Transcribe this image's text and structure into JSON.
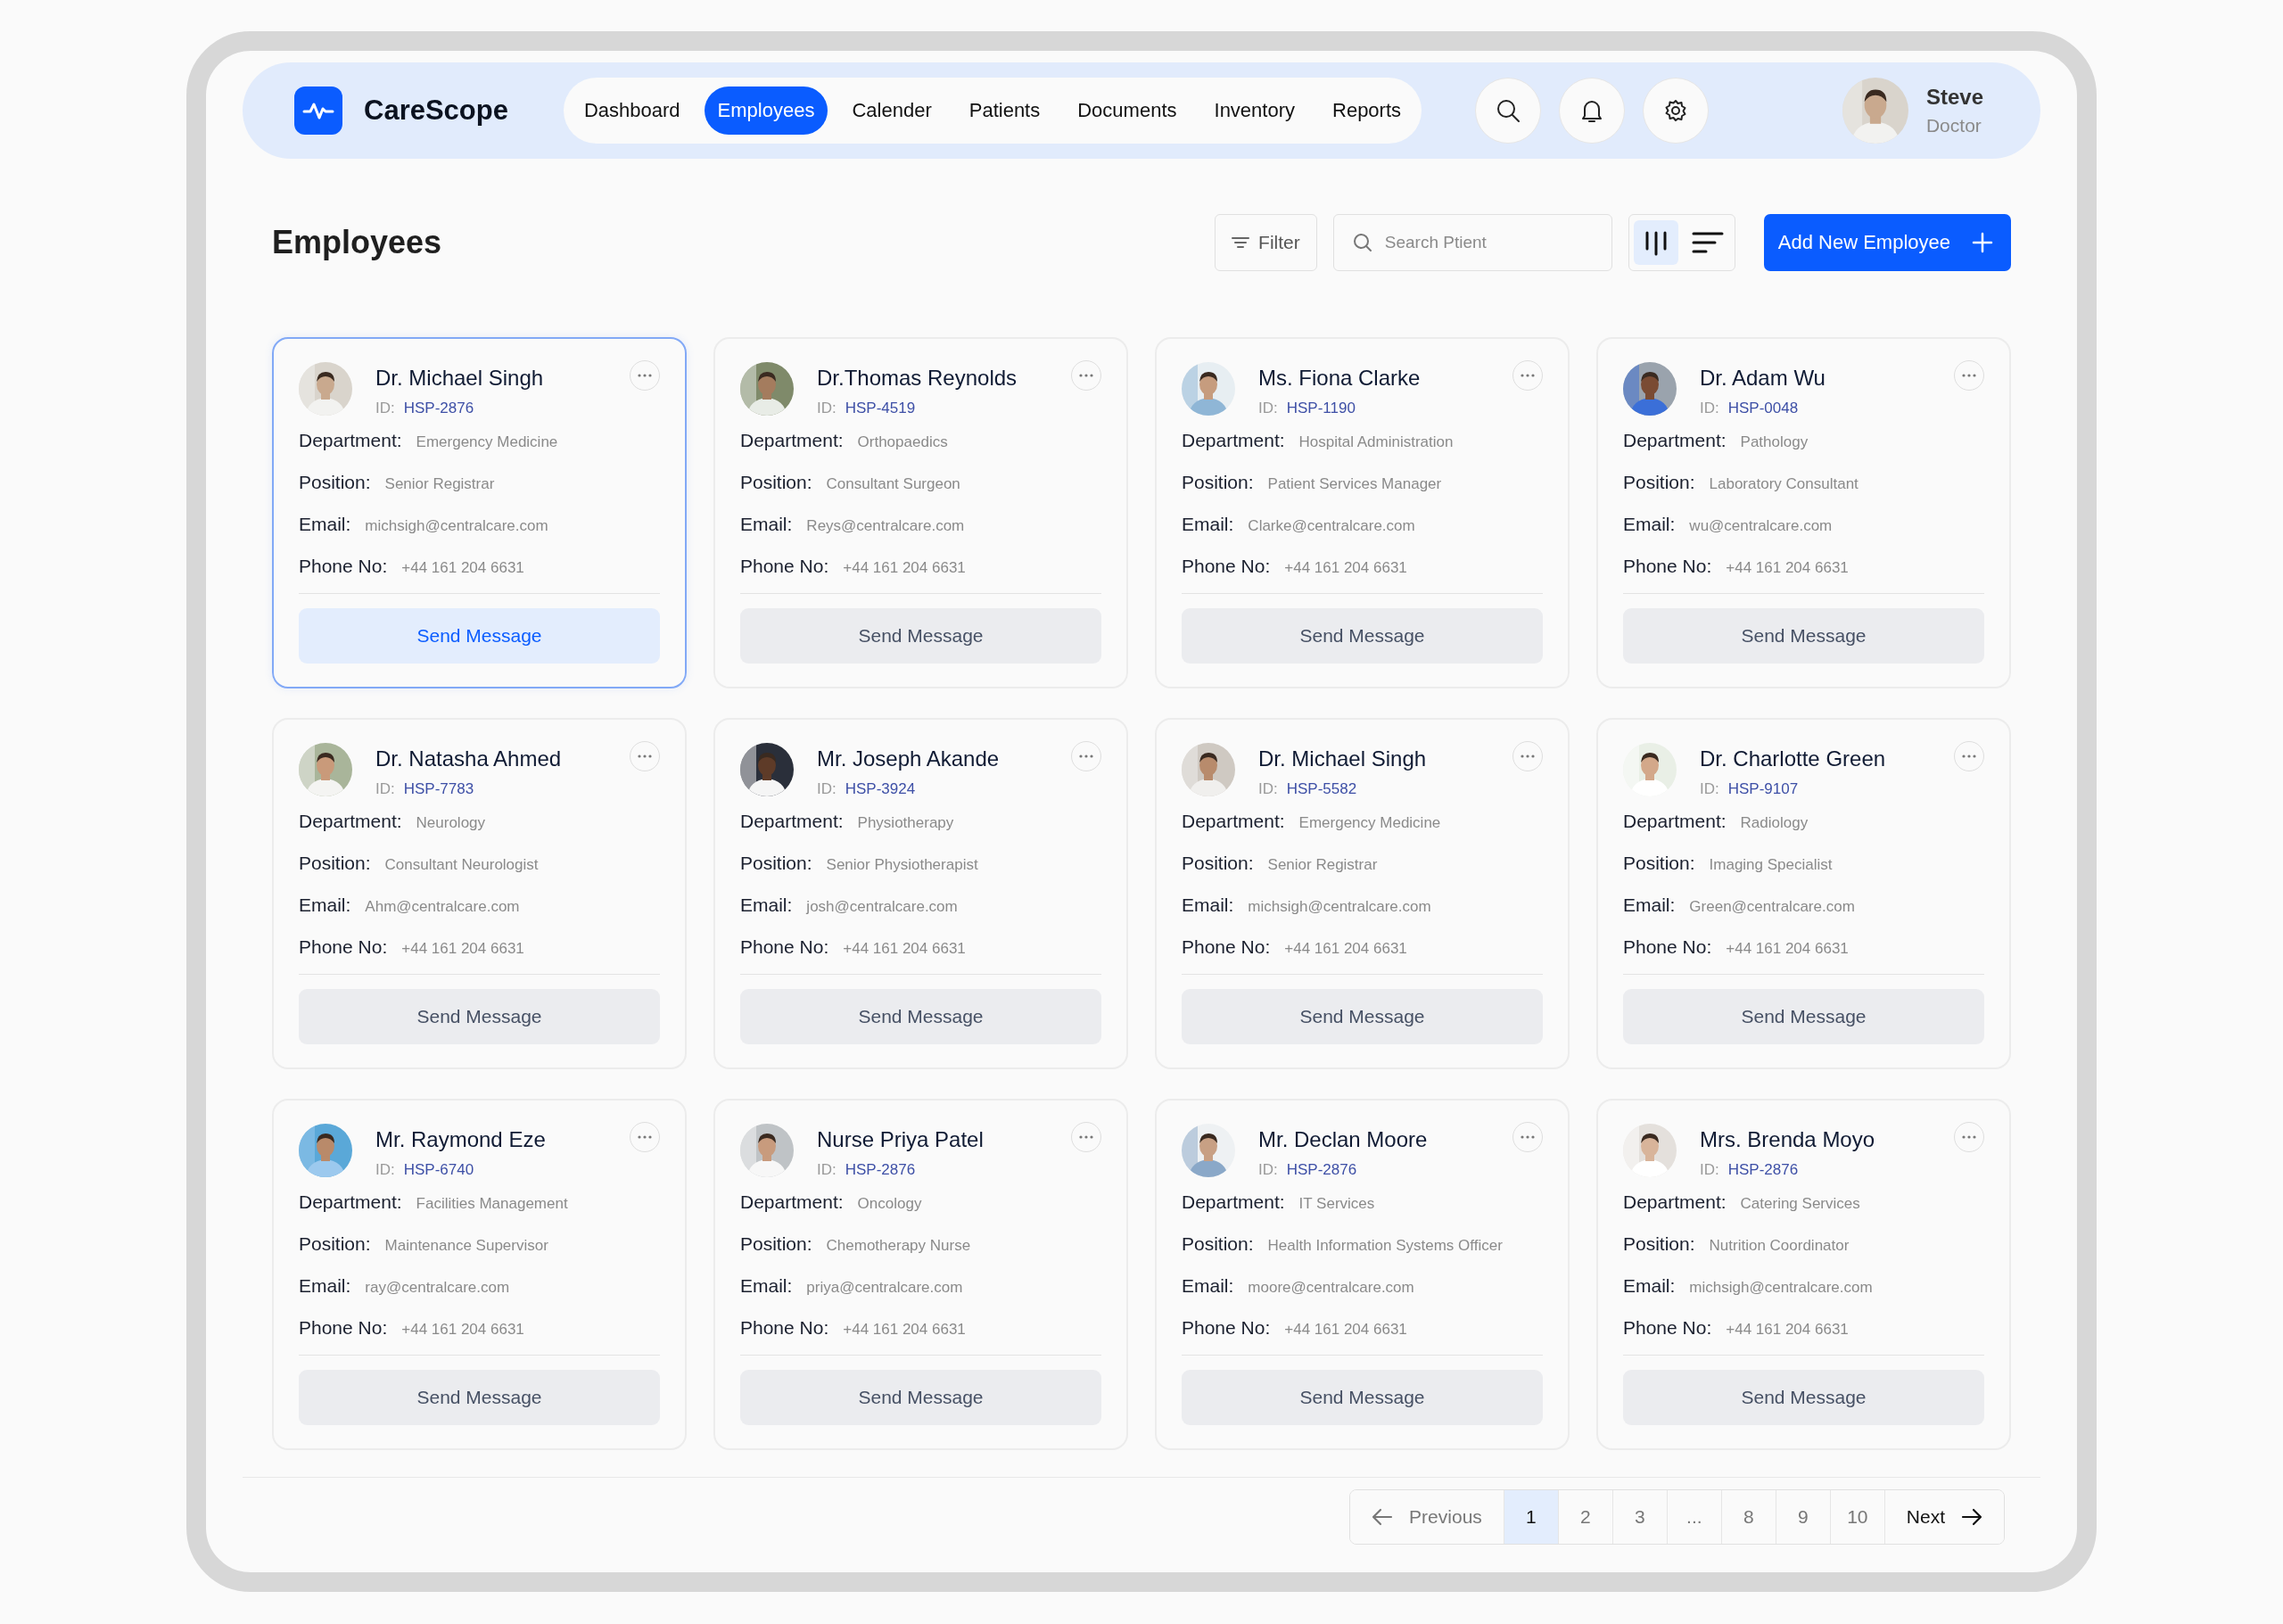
{
  "brand": {
    "name": "CareScope"
  },
  "nav": [
    {
      "label": "Dashboard",
      "selected": false
    },
    {
      "label": "Employees",
      "selected": true
    },
    {
      "label": "Calender",
      "selected": false
    },
    {
      "label": "Patients",
      "selected": false
    },
    {
      "label": "Documents",
      "selected": false
    },
    {
      "label": "Inventory",
      "selected": false
    },
    {
      "label": "Reports",
      "selected": false
    }
  ],
  "user": {
    "name": "Steve",
    "role": "Doctor"
  },
  "page_title": "Employees",
  "toolbar": {
    "filter": "Filter",
    "search": {
      "placeholder": "Search Ptient"
    },
    "view_options": [
      {
        "kind": "columns",
        "selected": true
      },
      {
        "kind": "rows",
        "selected": false
      }
    ],
    "add_button": "Add New Employee"
  },
  "employees": [
    {
      "name": "Dr. Michael Singh",
      "id_label": "ID:",
      "id": "HSP-2876",
      "selected": true,
      "fields": [
        {
          "label": "Department:",
          "value": "Emergency Medicine"
        },
        {
          "label": "Position:",
          "value": "Senior Registrar"
        },
        {
          "label": "Email:",
          "value": "michsigh@centralcare.com"
        },
        {
          "label": "Phone No:",
          "value": "+44 161 204 6631"
        }
      ],
      "button": "Send Message"
    },
    {
      "name": "Dr.Thomas Reynolds",
      "id_label": "ID:",
      "id": "HSP-4519",
      "selected": false,
      "fields": [
        {
          "label": "Department:",
          "value": "Orthopaedics"
        },
        {
          "label": "Position:",
          "value": "Consultant Surgeon"
        },
        {
          "label": "Email:",
          "value": "Reys@centralcare.com"
        },
        {
          "label": "Phone No:",
          "value": "+44 161 204 6631"
        }
      ],
      "button": "Send Message"
    },
    {
      "name": "Ms. Fiona Clarke",
      "id_label": "ID:",
      "id": "HSP-1190",
      "selected": false,
      "fields": [
        {
          "label": "Department:",
          "value": "Hospital Administration"
        },
        {
          "label": "Position:",
          "value": "Patient Services Manager"
        },
        {
          "label": "Email:",
          "value": "Clarke@centralcare.com"
        },
        {
          "label": "Phone No:",
          "value": "+44 161 204 6631"
        }
      ],
      "button": "Send Message"
    },
    {
      "name": "Dr. Adam Wu",
      "id_label": "ID:",
      "id": "HSP-0048",
      "selected": false,
      "fields": [
        {
          "label": "Department:",
          "value": "Pathology"
        },
        {
          "label": "Position:",
          "value": "Laboratory Consultant"
        },
        {
          "label": "Email:",
          "value": "wu@centralcare.com"
        },
        {
          "label": "Phone No:",
          "value": "+44 161 204 6631"
        }
      ],
      "button": "Send Message"
    },
    {
      "name": "Dr. Natasha Ahmed",
      "id_label": "ID:",
      "id": "HSP-7783",
      "selected": false,
      "fields": [
        {
          "label": "Department:",
          "value": "Neurology"
        },
        {
          "label": "Position:",
          "value": "Consultant Neurologist"
        },
        {
          "label": "Email:",
          "value": "Ahm@centralcare.com"
        },
        {
          "label": "Phone No:",
          "value": "+44 161 204 6631"
        }
      ],
      "button": "Send Message"
    },
    {
      "name": "Mr. Joseph Akande",
      "id_label": "ID:",
      "id": "HSP-3924",
      "selected": false,
      "fields": [
        {
          "label": "Department:",
          "value": "Physiotherapy"
        },
        {
          "label": "Position:",
          "value": "Senior Physiotherapist"
        },
        {
          "label": "Email:",
          "value": "josh@centralcare.com"
        },
        {
          "label": "Phone No:",
          "value": "+44 161 204 6631"
        }
      ],
      "button": "Send Message"
    },
    {
      "name": "Dr. Michael Singh",
      "id_label": "ID:",
      "id": "HSP-5582",
      "selected": false,
      "fields": [
        {
          "label": "Department:",
          "value": "Emergency Medicine"
        },
        {
          "label": "Position:",
          "value": "Senior Registrar"
        },
        {
          "label": "Email:",
          "value": "michsigh@centralcare.com"
        },
        {
          "label": "Phone No:",
          "value": "+44 161 204 6631"
        }
      ],
      "button": "Send Message"
    },
    {
      "name": "Dr. Charlotte Green",
      "id_label": "ID:",
      "id": "HSP-9107",
      "selected": false,
      "fields": [
        {
          "label": "Department:",
          "value": "Radiology"
        },
        {
          "label": "Position:",
          "value": "Imaging Specialist"
        },
        {
          "label": "Email:",
          "value": "Green@centralcare.com"
        },
        {
          "label": "Phone No:",
          "value": "+44 161 204 6631"
        }
      ],
      "button": "Send Message"
    },
    {
      "name": "Mr. Raymond Eze",
      "id_label": "ID:",
      "id": "HSP-6740",
      "selected": false,
      "fields": [
        {
          "label": "Department:",
          "value": "Facilities Management"
        },
        {
          "label": "Position:",
          "value": "Maintenance Supervisor"
        },
        {
          "label": "Email:",
          "value": "ray@centralcare.com"
        },
        {
          "label": "Phone No:",
          "value": "+44 161 204 6631"
        }
      ],
      "button": "Send Message"
    },
    {
      "name": "Nurse Priya Patel",
      "id_label": "ID:",
      "id": "HSP-2876",
      "selected": false,
      "fields": [
        {
          "label": "Department:",
          "value": "Oncology"
        },
        {
          "label": "Position:",
          "value": "Chemotherapy Nurse"
        },
        {
          "label": "Email:",
          "value": "priya@centralcare.com"
        },
        {
          "label": "Phone No:",
          "value": "+44 161 204 6631"
        }
      ],
      "button": "Send Message"
    },
    {
      "name": "Mr. Declan Moore",
      "id_label": "ID:",
      "id": "HSP-2876",
      "selected": false,
      "fields": [
        {
          "label": "Department:",
          "value": "IT Services"
        },
        {
          "label": "Position:",
          "value": "Health Information Systems Officer"
        },
        {
          "label": "Email:",
          "value": "moore@centralcare.com"
        },
        {
          "label": "Phone No:",
          "value": "+44 161 204 6631"
        }
      ],
      "button": "Send Message"
    },
    {
      "name": "Mrs. Brenda Moyo",
      "id_label": "ID:",
      "id": "HSP-2876",
      "selected": false,
      "fields": [
        {
          "label": "Department:",
          "value": "Catering Services"
        },
        {
          "label": "Position:",
          "value": "Nutrition Coordinator"
        },
        {
          "label": "Email:",
          "value": "michsigh@centralcare.com"
        },
        {
          "label": "Phone No:",
          "value": "+44 161 204 6631"
        }
      ],
      "button": "Send Message"
    }
  ],
  "pagination": {
    "previous": "Previous",
    "next": "Next",
    "pages": [
      {
        "label": "1",
        "selected": true
      },
      {
        "label": "2",
        "selected": false
      },
      {
        "label": "3",
        "selected": false
      },
      {
        "label": "...",
        "selected": false
      },
      {
        "label": "8",
        "selected": false
      },
      {
        "label": "9",
        "selected": false
      },
      {
        "label": "10",
        "selected": false
      }
    ]
  }
}
